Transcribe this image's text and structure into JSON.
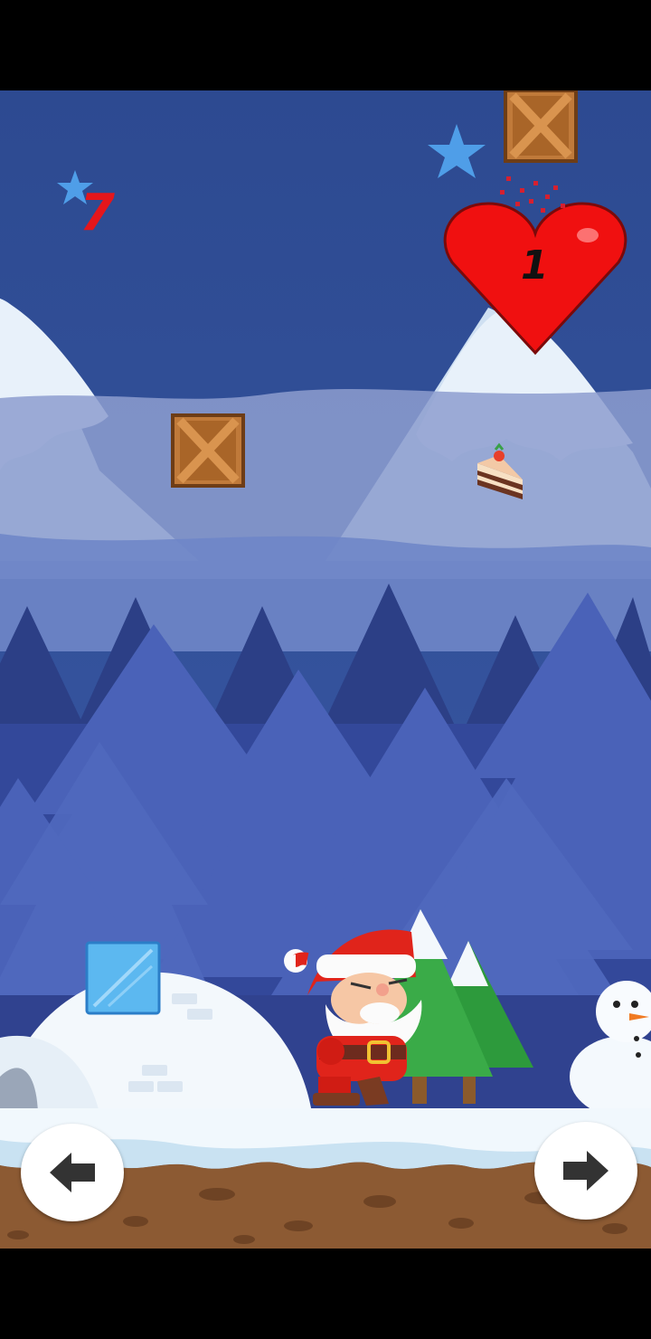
{
  "hud": {
    "star_count": "7",
    "lives": "1",
    "star_count_color": "#e5161b",
    "heart_color": "#f01010"
  },
  "controls": {
    "left": "arrow-left-icon",
    "right": "arrow-right-icon"
  },
  "palette": {
    "sky": "#2d4a91",
    "snow": "#eef6fb",
    "ground": "#8c5a33"
  }
}
